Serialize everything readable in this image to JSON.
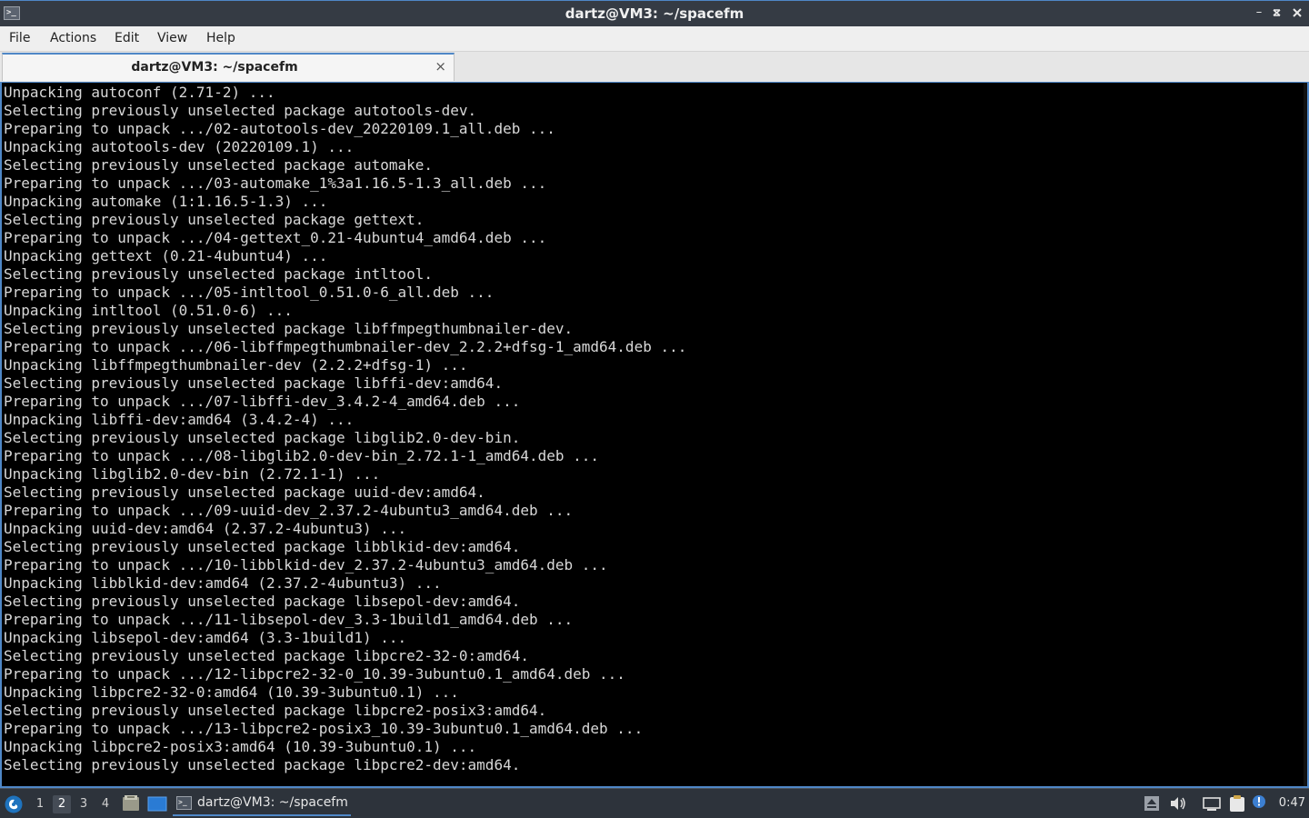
{
  "window": {
    "title": "dartz@VM3: ~/spacefm",
    "controls": {
      "minimize": "minimize-icon",
      "maximize": "restore-icon",
      "close": "close-icon"
    }
  },
  "menu": {
    "items": [
      "File",
      "Actions",
      "Edit",
      "View",
      "Help"
    ]
  },
  "tabs": [
    {
      "label": "dartz@VM3: ~/spacefm",
      "active": true
    }
  ],
  "terminal": {
    "background": "#000000",
    "foreground": "#d8d8d8",
    "lines": [
      "Unpacking autoconf (2.71-2) ...",
      "Selecting previously unselected package autotools-dev.",
      "Preparing to unpack .../02-autotools-dev_20220109.1_all.deb ...",
      "Unpacking autotools-dev (20220109.1) ...",
      "Selecting previously unselected package automake.",
      "Preparing to unpack .../03-automake_1%3a1.16.5-1.3_all.deb ...",
      "Unpacking automake (1:1.16.5-1.3) ...",
      "Selecting previously unselected package gettext.",
      "Preparing to unpack .../04-gettext_0.21-4ubuntu4_amd64.deb ...",
      "Unpacking gettext (0.21-4ubuntu4) ...",
      "Selecting previously unselected package intltool.",
      "Preparing to unpack .../05-intltool_0.51.0-6_all.deb ...",
      "Unpacking intltool (0.51.0-6) ...",
      "Selecting previously unselected package libffmpegthumbnailer-dev.",
      "Preparing to unpack .../06-libffmpegthumbnailer-dev_2.2.2+dfsg-1_amd64.deb ...",
      "Unpacking libffmpegthumbnailer-dev (2.2.2+dfsg-1) ...",
      "Selecting previously unselected package libffi-dev:amd64.",
      "Preparing to unpack .../07-libffi-dev_3.4.2-4_amd64.deb ...",
      "Unpacking libffi-dev:amd64 (3.4.2-4) ...",
      "Selecting previously unselected package libglib2.0-dev-bin.",
      "Preparing to unpack .../08-libglib2.0-dev-bin_2.72.1-1_amd64.deb ...",
      "Unpacking libglib2.0-dev-bin (2.72.1-1) ...",
      "Selecting previously unselected package uuid-dev:amd64.",
      "Preparing to unpack .../09-uuid-dev_2.37.2-4ubuntu3_amd64.deb ...",
      "Unpacking uuid-dev:amd64 (2.37.2-4ubuntu3) ...",
      "Selecting previously unselected package libblkid-dev:amd64.",
      "Preparing to unpack .../10-libblkid-dev_2.37.2-4ubuntu3_amd64.deb ...",
      "Unpacking libblkid-dev:amd64 (2.37.2-4ubuntu3) ...",
      "Selecting previously unselected package libsepol-dev:amd64.",
      "Preparing to unpack .../11-libsepol-dev_3.3-1build1_amd64.deb ...",
      "Unpacking libsepol-dev:amd64 (3.3-1build1) ...",
      "Selecting previously unselected package libpcre2-32-0:amd64.",
      "Preparing to unpack .../12-libpcre2-32-0_10.39-3ubuntu0.1_amd64.deb ...",
      "Unpacking libpcre2-32-0:amd64 (10.39-3ubuntu0.1) ...",
      "Selecting previously unselected package libpcre2-posix3:amd64.",
      "Preparing to unpack .../13-libpcre2-posix3_10.39-3ubuntu0.1_amd64.deb ...",
      "Unpacking libpcre2-posix3:amd64 (10.39-3ubuntu0.1) ...",
      "Selecting previously unselected package libpcre2-dev:amd64."
    ]
  },
  "taskbar": {
    "start_icon": "lxqt-start-icon",
    "workspaces": [
      "1",
      "2",
      "3",
      "4"
    ],
    "active_workspace": "2",
    "quicklaunch": [
      "file-manager-icon",
      "show-desktop-icon"
    ],
    "tasks": [
      {
        "label": "dartz@VM3: ~/spacefm",
        "icon": "terminal-icon"
      }
    ],
    "tray": [
      "eject-icon",
      "volume-icon",
      "network-icon",
      "clipboard-icon",
      "notification-icon"
    ],
    "clock": "0:47"
  },
  "colors": {
    "accent": "#4f87c7",
    "titlebar": "#353b44",
    "taskbar": "#2d333b",
    "menubar": "#efefef"
  }
}
